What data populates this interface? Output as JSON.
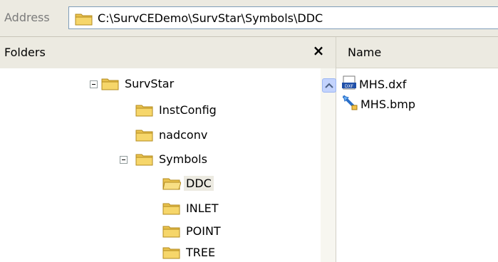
{
  "address": {
    "label": "Address",
    "path": "C:\\SurvCEDemo\\SurvStar\\Symbols\\DDC"
  },
  "folders_pane": {
    "title": "Folders",
    "close": "×",
    "tree": [
      {
        "label": "SurvStar",
        "expanded": true
      },
      {
        "label": "InstConfig"
      },
      {
        "label": "nadconv"
      },
      {
        "label": "Symbols",
        "expanded": true
      },
      {
        "label": "DDC",
        "selected": true
      },
      {
        "label": "INLET"
      },
      {
        "label": "POINT"
      },
      {
        "label": "TREE"
      }
    ]
  },
  "files_pane": {
    "column_header": "Name",
    "files": [
      {
        "name": "MHS.dxf",
        "icon": "dxf-file-icon"
      },
      {
        "name": "MHS.bmp",
        "icon": "bmp-file-icon"
      }
    ]
  },
  "colors": {
    "folder": "#f6d66a",
    "toolbar": "#eceae1",
    "selection": "#eceae1"
  }
}
